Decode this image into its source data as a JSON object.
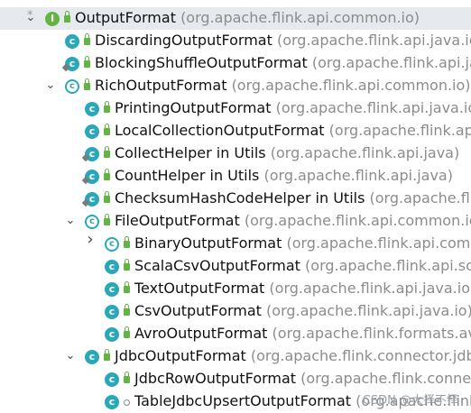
{
  "tree": {
    "rows": [
      {
        "name": "OutputFormat",
        "pkg": "(org.apache.flink.api.common.io)",
        "icon": "interface",
        "iconLetter": "I",
        "indent": 0,
        "arrow": "chevron-down",
        "selected": true,
        "star": true,
        "lock": "closed"
      },
      {
        "name": "DiscardingOutputFormat",
        "pkg": "(org.apache.flink.api.java.io)",
        "icon": "class",
        "iconLetter": "c",
        "indent": 1,
        "arrow": "",
        "lock": "closed"
      },
      {
        "name": "BlockingShuffleOutputFormat",
        "pkg": "(org.apache.flink.api.java.",
        "icon": "class",
        "iconLetter": "c",
        "indent": 1,
        "arrow": "",
        "lock": "closed",
        "pin": true
      },
      {
        "name": "RichOutputFormat",
        "pkg": "(org.apache.flink.api.common.io)",
        "icon": "abstract",
        "iconLetter": "c",
        "indent": 1,
        "arrow": "chevron-down",
        "lock": "closed"
      },
      {
        "name": "PrintingOutputFormat",
        "pkg": "(org.apache.flink.api.java.io)",
        "icon": "class",
        "iconLetter": "c",
        "indent": 2,
        "arrow": "",
        "lock": "closed"
      },
      {
        "name": "LocalCollectionOutputFormat",
        "pkg": "(org.apache.flink.api.jav",
        "icon": "class",
        "iconLetter": "c",
        "indent": 2,
        "arrow": "",
        "lock": "closed"
      },
      {
        "name": "CollectHelper in Utils",
        "pkg": "(org.apache.flink.api.java)",
        "icon": "class",
        "iconLetter": "c",
        "indent": 2,
        "arrow": "",
        "lock": "closed",
        "pin": true
      },
      {
        "name": "CountHelper in Utils",
        "pkg": "(org.apache.flink.api.java)",
        "icon": "class",
        "iconLetter": "c",
        "indent": 2,
        "arrow": "",
        "lock": "closed",
        "pin": true
      },
      {
        "name": "ChecksumHashCodeHelper in Utils",
        "pkg": "(org.apache.flink.a",
        "icon": "class",
        "iconLetter": "c",
        "indent": 2,
        "arrow": "",
        "lock": "closed",
        "pin": true
      },
      {
        "name": "FileOutputFormat",
        "pkg": "(org.apache.flink.api.common.io)",
        "icon": "abstract",
        "iconLetter": "c",
        "indent": 2,
        "arrow": "chevron-down",
        "lock": "closed"
      },
      {
        "name": "BinaryOutputFormat",
        "pkg": "(org.apache.flink.api.commo",
        "icon": "abstract",
        "iconLetter": "c",
        "indent": 3,
        "arrow": "chevron-right",
        "lock": "closed"
      },
      {
        "name": "ScalaCsvOutputFormat",
        "pkg": "(org.apache.flink.api.scala.",
        "icon": "class",
        "iconLetter": "c",
        "indent": 3,
        "arrow": "",
        "lock": "closed"
      },
      {
        "name": "TextOutputFormat",
        "pkg": "(org.apache.flink.api.java.io)",
        "icon": "class",
        "iconLetter": "c",
        "indent": 3,
        "arrow": "",
        "lock": "closed"
      },
      {
        "name": "CsvOutputFormat",
        "pkg": "(org.apache.flink.api.java.io)",
        "icon": "class",
        "iconLetter": "c",
        "indent": 3,
        "arrow": "",
        "lock": "closed"
      },
      {
        "name": "AvroOutputFormat",
        "pkg": "(org.apache.flink.formats.avro)",
        "icon": "class",
        "iconLetter": "c",
        "indent": 3,
        "arrow": "",
        "lock": "closed"
      },
      {
        "name": "JdbcOutputFormat",
        "pkg": "(org.apache.flink.connector.jdbc.i",
        "icon": "class",
        "iconLetter": "c",
        "indent": 2,
        "arrow": "chevron-down",
        "lock": "closed"
      },
      {
        "name": "JdbcRowOutputFormat",
        "pkg": "(org.apache.flink.connecto",
        "icon": "class",
        "iconLetter": "c",
        "indent": 3,
        "arrow": "",
        "lock": "closed"
      },
      {
        "name": "TableJdbcUpsertOutputFormat",
        "pkg": "(org.apache.flink.c",
        "icon": "class",
        "iconLetter": "c",
        "indent": 3,
        "arrow": "",
        "lock": "open"
      }
    ]
  },
  "watermark": "CSDN @大择不择",
  "colors": {
    "class_icon": "#2aa7b8",
    "interface_icon": "#62b543",
    "selected_row": "#e6e9ee",
    "package_text": "#8c8c8c"
  }
}
